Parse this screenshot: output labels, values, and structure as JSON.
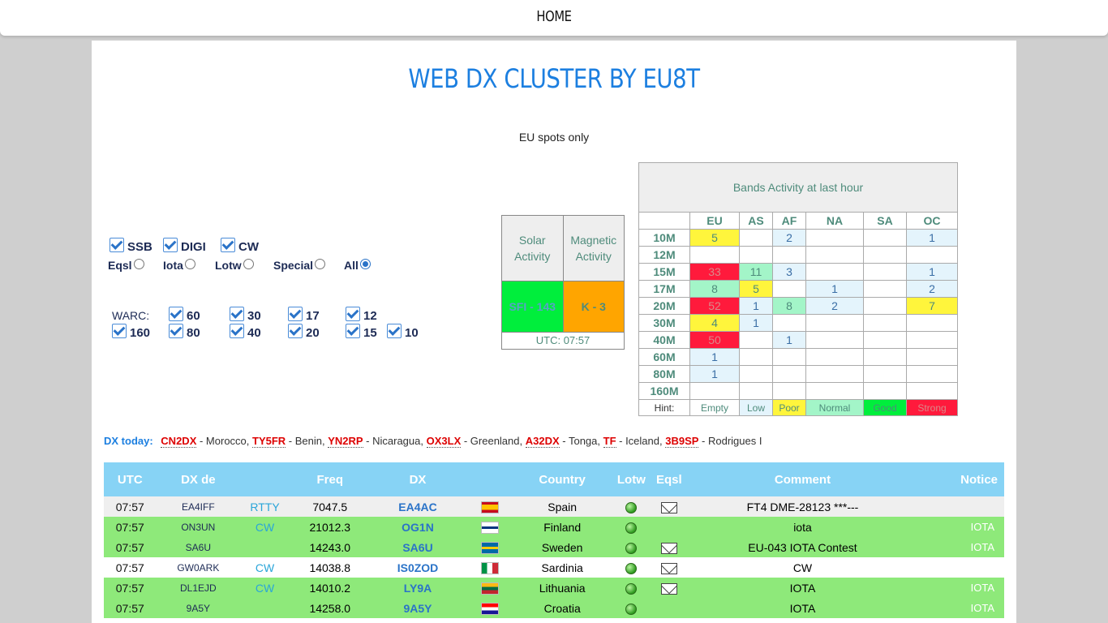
{
  "nav": {
    "home": "HOME"
  },
  "title": "WEB DX CLUSTER BY EU8T",
  "subtitle": "EU spots only",
  "filters": {
    "modes": [
      "SSB",
      "DIGI",
      "CW"
    ],
    "radios": [
      "Eqsl",
      "Iota",
      "Lotw",
      "Special",
      "All"
    ],
    "selected_radio": "All",
    "warc_label": "WARC:",
    "bands_row1": [
      "60",
      "30",
      "17",
      "12"
    ],
    "bands_row2": [
      "160",
      "80",
      "40",
      "20",
      "15",
      "10"
    ]
  },
  "solar": {
    "solar_label": "Solar Activity",
    "magnetic_label": "Magnetic Activity",
    "sfi": "SFI - 143",
    "k": "K - 3",
    "utc": "UTC: 07:57",
    "colors": {
      "sfi": "#00ee3c",
      "k": "#ffa500"
    }
  },
  "bands_activity": {
    "caption": "Bands Activity at last hour",
    "regions": [
      "EU",
      "AS",
      "AF",
      "NA",
      "SA",
      "OC"
    ],
    "rows": [
      {
        "band": "10M",
        "cells": [
          {
            "v": "5",
            "c": "poor"
          },
          {
            "v": "",
            "c": ""
          },
          {
            "v": "2",
            "c": "low"
          },
          {
            "v": "",
            "c": ""
          },
          {
            "v": "",
            "c": ""
          },
          {
            "v": "1",
            "c": "low"
          }
        ]
      },
      {
        "band": "12M",
        "cells": [
          {
            "v": "",
            "c": ""
          },
          {
            "v": "",
            "c": ""
          },
          {
            "v": "",
            "c": ""
          },
          {
            "v": "",
            "c": ""
          },
          {
            "v": "",
            "c": ""
          },
          {
            "v": "",
            "c": ""
          }
        ]
      },
      {
        "band": "15M",
        "cells": [
          {
            "v": "33",
            "c": "strong"
          },
          {
            "v": "11",
            "c": "normal"
          },
          {
            "v": "3",
            "c": "low"
          },
          {
            "v": "",
            "c": ""
          },
          {
            "v": "",
            "c": ""
          },
          {
            "v": "1",
            "c": "low"
          }
        ]
      },
      {
        "band": "17M",
        "cells": [
          {
            "v": "8",
            "c": "normal"
          },
          {
            "v": "5",
            "c": "poor"
          },
          {
            "v": "",
            "c": ""
          },
          {
            "v": "1",
            "c": "low"
          },
          {
            "v": "",
            "c": ""
          },
          {
            "v": "2",
            "c": "low"
          }
        ]
      },
      {
        "band": "20M",
        "cells": [
          {
            "v": "52",
            "c": "strong"
          },
          {
            "v": "1",
            "c": "low"
          },
          {
            "v": "8",
            "c": "normal"
          },
          {
            "v": "2",
            "c": "low"
          },
          {
            "v": "",
            "c": ""
          },
          {
            "v": "7",
            "c": "poor"
          }
        ]
      },
      {
        "band": "30M",
        "cells": [
          {
            "v": "4",
            "c": "poor"
          },
          {
            "v": "1",
            "c": "low"
          },
          {
            "v": "",
            "c": ""
          },
          {
            "v": "",
            "c": ""
          },
          {
            "v": "",
            "c": ""
          },
          {
            "v": "",
            "c": ""
          }
        ]
      },
      {
        "band": "40M",
        "cells": [
          {
            "v": "50",
            "c": "strong"
          },
          {
            "v": "",
            "c": ""
          },
          {
            "v": "1",
            "c": "low"
          },
          {
            "v": "",
            "c": ""
          },
          {
            "v": "",
            "c": ""
          },
          {
            "v": "",
            "c": ""
          }
        ]
      },
      {
        "band": "60M",
        "cells": [
          {
            "v": "1",
            "c": "low"
          },
          {
            "v": "",
            "c": ""
          },
          {
            "v": "",
            "c": ""
          },
          {
            "v": "",
            "c": ""
          },
          {
            "v": "",
            "c": ""
          },
          {
            "v": "",
            "c": ""
          }
        ]
      },
      {
        "band": "80M",
        "cells": [
          {
            "v": "1",
            "c": "low"
          },
          {
            "v": "",
            "c": ""
          },
          {
            "v": "",
            "c": ""
          },
          {
            "v": "",
            "c": ""
          },
          {
            "v": "",
            "c": ""
          },
          {
            "v": "",
            "c": ""
          }
        ]
      },
      {
        "band": "160M",
        "cells": [
          {
            "v": "",
            "c": ""
          },
          {
            "v": "",
            "c": ""
          },
          {
            "v": "",
            "c": ""
          },
          {
            "v": "",
            "c": ""
          },
          {
            "v": "",
            "c": ""
          },
          {
            "v": "",
            "c": ""
          }
        ]
      }
    ],
    "hint_label": "Hint:",
    "hints": [
      {
        "label": "Empty",
        "c": ""
      },
      {
        "label": "Low",
        "c": "low"
      },
      {
        "label": "Poor",
        "c": "poor"
      },
      {
        "label": "Normal",
        "c": "normal"
      },
      {
        "label": "Good",
        "c": "good"
      },
      {
        "label": "Strong",
        "c": "strong"
      }
    ],
    "colors": {
      "low": "#e4f4fc",
      "poor": "#fff53c",
      "normal": "#a3f5c8",
      "good": "#00ee3c",
      "strong": "#ff1a3c"
    }
  },
  "dx_today": {
    "label": "DX today:",
    "items": [
      {
        "call": "CN2DX",
        "country": "Morocco"
      },
      {
        "call": "TY5FR",
        "country": "Benin"
      },
      {
        "call": "YN2RP",
        "country": "Nicaragua"
      },
      {
        "call": "OX3LX",
        "country": "Greenland"
      },
      {
        "call": "A32DX",
        "country": "Tonga"
      },
      {
        "call": "TF",
        "country": "Iceland"
      },
      {
        "call": "3B9SP",
        "country": "Rodrigues I"
      }
    ]
  },
  "spots": {
    "headers": [
      "UTC",
      "DX de",
      "",
      "Freq",
      "DX",
      "",
      "Country",
      "Lotw",
      "Eqsl",
      "Comment",
      "Notice"
    ],
    "rows": [
      {
        "style": "l",
        "utc": "07:57",
        "de": "EA4IFF",
        "mode": "RTTY",
        "freq": "7047.5",
        "dx": "EA4AC",
        "flag": "es",
        "country": "Spain",
        "lotw": true,
        "eqsl": true,
        "comment": "FT4 DME-28123 ***---",
        "notice": ""
      },
      {
        "style": "g",
        "utc": "07:57",
        "de": "ON3UN",
        "mode": "CW",
        "freq": "21012.3",
        "dx": "OG1N",
        "flag": "fi",
        "country": "Finland",
        "lotw": true,
        "eqsl": false,
        "comment": "iota",
        "notice": "IOTA"
      },
      {
        "style": "g",
        "utc": "07:57",
        "de": "SA6U",
        "mode": "",
        "freq": "14243.0",
        "dx": "SA6U",
        "flag": "se",
        "country": "Sweden",
        "lotw": true,
        "eqsl": true,
        "comment": "EU-043 IOTA Contest",
        "notice": "IOTA"
      },
      {
        "style": "w",
        "utc": "07:57",
        "de": "GW0ARK",
        "mode": "CW",
        "freq": "14038.8",
        "dx": "IS0ZOD",
        "flag": "it",
        "country": "Sardinia",
        "lotw": true,
        "eqsl": true,
        "comment": "CW",
        "notice": ""
      },
      {
        "style": "g",
        "utc": "07:57",
        "de": "DL1EJD",
        "mode": "CW",
        "freq": "14010.2",
        "dx": "LY9A",
        "flag": "lt",
        "country": "Lithuania",
        "lotw": true,
        "eqsl": true,
        "comment": "IOTA",
        "notice": "IOTA"
      },
      {
        "style": "g",
        "utc": "07:57",
        "de": "9A5Y",
        "mode": "",
        "freq": "14258.0",
        "dx": "9A5Y",
        "flag": "hr",
        "country": "Croatia",
        "lotw": true,
        "eqsl": false,
        "comment": "IOTA",
        "notice": "IOTA"
      }
    ]
  }
}
